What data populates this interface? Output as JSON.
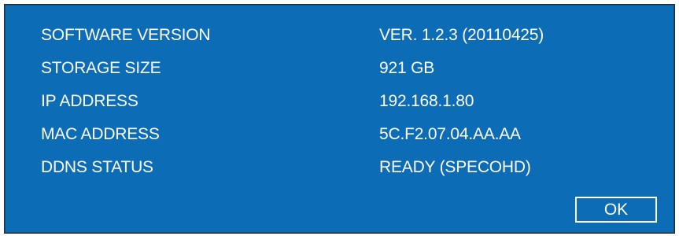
{
  "system_info": {
    "rows": [
      {
        "label": "SOFTWARE VERSION",
        "value": "VER. 1.2.3 (20110425)"
      },
      {
        "label": "STORAGE SIZE",
        "value": "921 GB"
      },
      {
        "label": "IP ADDRESS",
        "value": "192.168.1.80"
      },
      {
        "label": "MAC ADDRESS",
        "value": "5C.F2.07.04.AA.AA"
      },
      {
        "label": "DDNS STATUS",
        "value": "READY (SPECOHD)"
      }
    ],
    "ok_label": "OK"
  },
  "colors": {
    "dialog_background": "#0c6cb5",
    "text": "#ffffff"
  }
}
